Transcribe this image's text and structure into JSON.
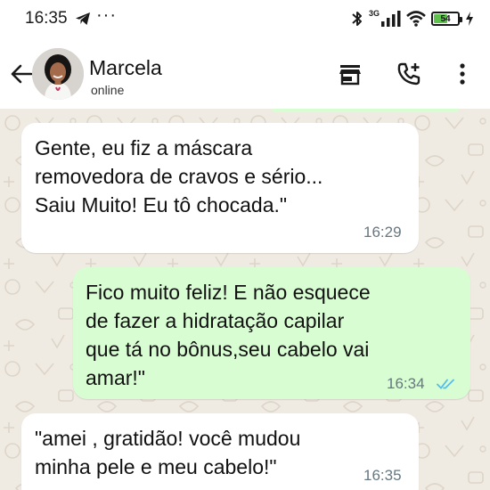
{
  "status_bar": {
    "time": "16:35",
    "dots": "···",
    "network": "3G",
    "battery": "54",
    "battery_level": 0.54
  },
  "header": {
    "name": "Marcela",
    "status": "online"
  },
  "messages": [
    {
      "direction": "incoming",
      "text": "Gente, eu fiz a máscara\nremovedora de cravos e sério...\nSaiu Muito! Eu tô chocada.\"",
      "time": "16:29"
    },
    {
      "direction": "outgoing",
      "text": "Fico muito feliz! E não esquece\nde fazer a hidratação capilar\nque tá no bônus,seu cabelo vai\namar!\"",
      "time": "16:34",
      "read": true
    },
    {
      "direction": "incoming",
      "text": "\"amei , gratidão! você mudou\nminha pele e meu cabelo!\"",
      "time": "16:35"
    }
  ],
  "colors": {
    "chat_background": "#efeae2",
    "incoming_bubble": "#ffffff",
    "outgoing_bubble": "#d9fdd3",
    "read_ticks": "#53bdeb",
    "timestamp": "#667781"
  },
  "icons": [
    "back-arrow-icon",
    "store-icon",
    "add-call-icon",
    "more-vert-icon",
    "bluetooth-icon",
    "signal-icon",
    "wifi-icon",
    "battery-icon",
    "charging-icon",
    "telegram-icon",
    "double-check-icon"
  ]
}
